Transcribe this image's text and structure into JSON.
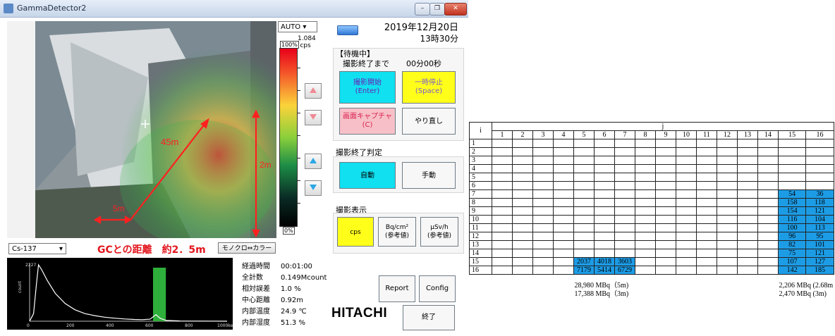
{
  "window": {
    "title": "GammaDetector2",
    "controls": [
      "–",
      "❐",
      "✕"
    ]
  },
  "camera": {
    "label_45m": "45m",
    "label_2m": "2m",
    "label_5m": "5m"
  },
  "scale": {
    "mode": "AUTO",
    "max_value": "1.084",
    "unit": "cps",
    "pct_top": "100%",
    "pct_bottom": "0%"
  },
  "datetime": {
    "date": "2019年12月20日",
    "time": "13時30分"
  },
  "status": {
    "title": "【待機中】",
    "remain_label": "撮影終了まで",
    "remain_value": "00分00秒"
  },
  "buttons": {
    "start": [
      "撮影開始",
      "(Enter)"
    ],
    "pause": [
      "一時停止",
      "(Space)"
    ],
    "capture": [
      "画面キャプチャ",
      "(C)"
    ],
    "redo": "やり直し",
    "auto": "自動",
    "manual": "手動",
    "cps": "cps",
    "bq": [
      "Bq/cm²",
      "(参考値)"
    ],
    "usv": [
      "μSv/h",
      "(参考値)"
    ],
    "report": "Report",
    "config": "Config",
    "exit": "終了",
    "mono": "モノクロ⇔カラー"
  },
  "sections": {
    "end_judge": "撮影終了判定",
    "display": "撮影表示"
  },
  "brand": "HITACHI",
  "nuclide": "Cs-137",
  "distance_text": "GCとの距離　約2．5m",
  "spectrum": {
    "ymax_label": "2227",
    "ylabel": "count",
    "xticks": [
      "0",
      "200",
      "400",
      "600",
      "800",
      "1000keV"
    ],
    "curve": [
      [
        0,
        0
      ],
      [
        20,
        300
      ],
      [
        35,
        1500
      ],
      [
        45,
        2227
      ],
      [
        60,
        2050
      ],
      [
        90,
        1600
      ],
      [
        130,
        1100
      ],
      [
        180,
        700
      ],
      [
        230,
        450
      ],
      [
        280,
        300
      ],
      [
        330,
        220
      ],
      [
        380,
        160
      ],
      [
        430,
        120
      ],
      [
        480,
        90
      ],
      [
        530,
        70
      ],
      [
        570,
        60
      ],
      [
        610,
        80
      ],
      [
        640,
        260
      ],
      [
        660,
        120
      ],
      [
        690,
        30
      ],
      [
        760,
        10
      ],
      [
        860,
        5
      ],
      [
        1000,
        0
      ]
    ],
    "roi": [
      625,
      690
    ],
    "xmax": 1000,
    "ymax": 2227
  },
  "stats": [
    {
      "label": "経過時間",
      "value": "00:01:00"
    },
    {
      "label": "全計数",
      "value": "0.149Mcount"
    },
    {
      "label": "相対誤差",
      "value": "1.0 %"
    },
    {
      "label": "中心距離",
      "value": "0.92m"
    },
    {
      "label": "内部温度",
      "value": "24.9 ℃"
    },
    {
      "label": "内部湿度",
      "value": "51.3 %"
    }
  ],
  "table": {
    "row_axis": "i",
    "col_axis": "j",
    "columns": [
      "1",
      "2",
      "3",
      "4",
      "5",
      "6",
      "7",
      "8",
      "9",
      "10",
      "11",
      "12",
      "13",
      "14",
      "15",
      "16"
    ],
    "rows": [
      "1",
      "2",
      "3",
      "4",
      "5",
      "6",
      "7",
      "8",
      "9",
      "10",
      "11",
      "12",
      "13",
      "14",
      "15",
      "16"
    ],
    "cells": {
      "7": {
        "15": "54",
        "16": "36"
      },
      "8": {
        "15": "158",
        "16": "118"
      },
      "9": {
        "15": "154",
        "16": "121"
      },
      "10": {
        "15": "116",
        "16": "104"
      },
      "11": {
        "15": "100",
        "16": "113"
      },
      "12": {
        "15": "96",
        "16": "95"
      },
      "13": {
        "15": "82",
        "16": "101"
      },
      "14": {
        "15": "75",
        "16": "121"
      },
      "15": {
        "5": "2037",
        "6": "4018",
        "7": "3603",
        "15": "107",
        "16": "127"
      },
      "16": {
        "5": "7179",
        "6": "5414",
        "7": "6729",
        "15": "142",
        "16": "185"
      }
    },
    "notes_left": [
      "28,980 MBq（5m)",
      "17,388 MBq（3m)"
    ],
    "notes_right": [
      "2,206 MBq (2.68m",
      "2,470 MBq (3m)"
    ]
  }
}
